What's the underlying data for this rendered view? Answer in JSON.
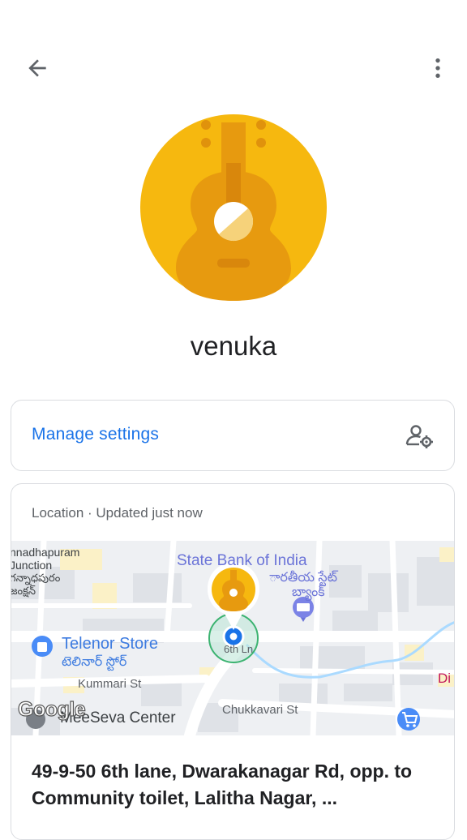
{
  "toolbar": {
    "back_icon": "arrow-left-icon",
    "more_icon": "more-vert-icon"
  },
  "profile": {
    "name": "venuka",
    "avatar_icon": "guitar-icon",
    "avatar_color": "#F6B80F"
  },
  "manage": {
    "label": "Manage settings",
    "icon": "person-settings-icon",
    "accent": "#1A73E8"
  },
  "location": {
    "header": "Location · Updated just now",
    "map": {
      "labels": {
        "junction_en_1": "nnadhapuram",
        "junction_en_2": "Junction",
        "junction_te_1": "గన్నాధపురం",
        "junction_te_2": "జంక్షన్",
        "bank_en": "State Bank of India",
        "bank_te_1": "ారతీయ స్టేట్",
        "bank_te_2": "బ్యాంక్",
        "store_en": "Telenor Store",
        "store_te": "టెలినార్ స్టోర్",
        "street_6th": "6th Ln",
        "street_kummari": "Kummari St",
        "center": "MeeSeva Center",
        "street_chukkavari": "Chukkavari St",
        "edge_label": "Di",
        "google": "Google"
      },
      "pin_icon": "guitar-icon",
      "bank_icon": "bank-icon",
      "store_icon": "shopping-bag-icon",
      "cart_icon": "shopping-cart-icon",
      "location_dot_color": "#1A73E8"
    },
    "address": "49-9-50 6th lane, Dwarakanagar Rd, opp. to Community toilet, Lalitha Nagar, ..."
  }
}
